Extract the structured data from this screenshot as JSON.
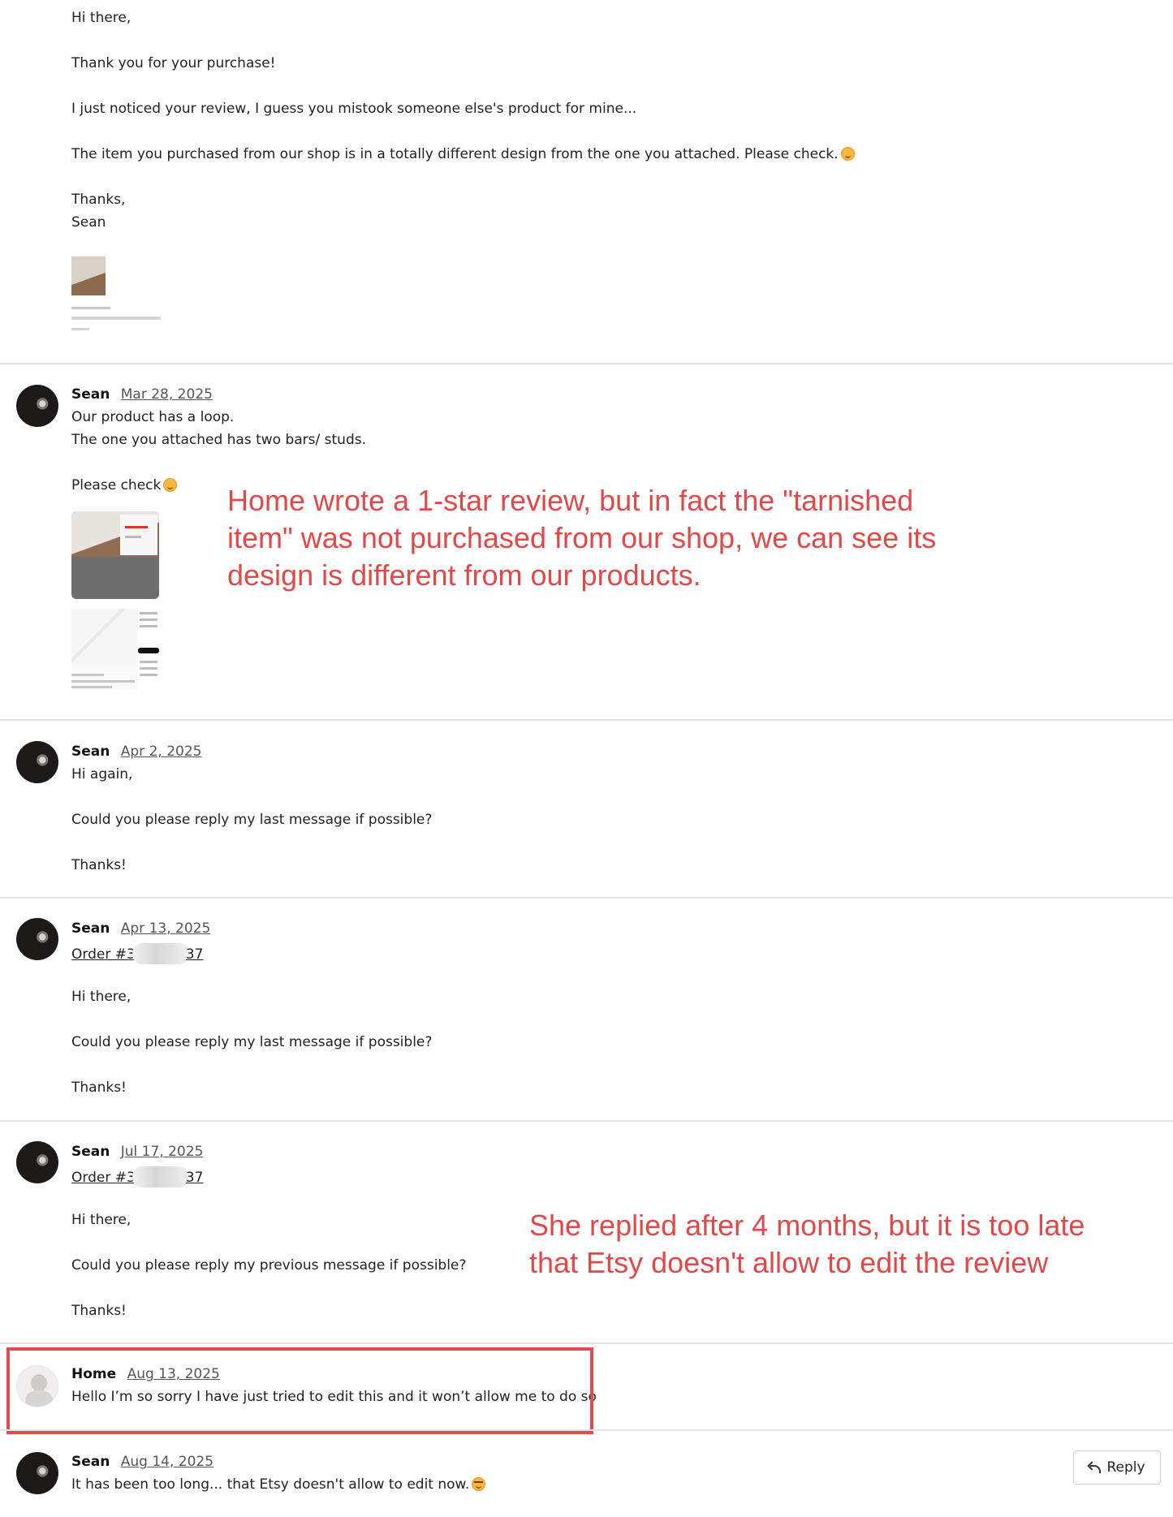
{
  "messages": [
    {
      "lines": [
        "Hi there,",
        "Thank you for your purchase!",
        "I just noticed your review, I guess you mistook someone else's product for mine...",
        "The item you purchased from our shop is in a totally different design from the one you attached. Please check.",
        "Thanks,",
        "Sean"
      ]
    },
    {
      "author": "Sean",
      "date": "Mar 28, 2025",
      "lines": [
        "Our product has a loop.",
        "The one you attached has two bars/ studs.",
        "Please check"
      ]
    },
    {
      "author": "Sean",
      "date": "Apr 2, 2025",
      "lines": [
        "Hi again,",
        "Could you please reply my last message if possible?",
        "Thanks!"
      ]
    },
    {
      "author": "Sean",
      "date": "Apr 13, 2025",
      "order_prefix": "Order #3",
      "order_suffix": "37",
      "lines": [
        "Hi there,",
        "Could you please reply my last message if possible?",
        "Thanks!"
      ]
    },
    {
      "author": "Sean",
      "date": "Jul 17, 2025",
      "order_prefix": "Order #3",
      "order_suffix": "37",
      "lines": [
        "Hi there,",
        "Could you please reply my previous message if possible?",
        "Thanks!"
      ]
    },
    {
      "author": "Home",
      "date": "Aug 13, 2025",
      "lines": [
        "Hello I’m so sorry I have just tried to edit this and it won’t allow me to do so"
      ]
    },
    {
      "author": "Sean",
      "date": "Aug 14, 2025",
      "lines": [
        "It has been too long... that Etsy doesn't allow to edit now."
      ]
    }
  ],
  "annotations": {
    "first": [
      "Home wrote a 1-star review, but in fact the \"tarnished",
      "item\" was not purchased from our shop, we can see its",
      "design is different from our products."
    ],
    "second": [
      "She replied after 4 months, but it is too late",
      "that Etsy doesn't allow to edit the review"
    ]
  },
  "reply_button": {
    "label": "Reply",
    "icon": "reply-arrow-icon"
  },
  "colors": {
    "annotation": "#e0494a",
    "highlight_border": "#e24b4f",
    "divider": "#e4e4e4"
  }
}
